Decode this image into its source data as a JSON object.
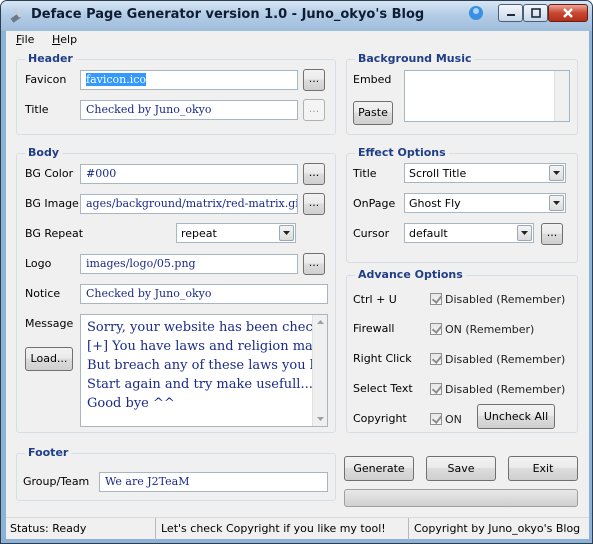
{
  "window": {
    "title": "Deface Page Generator version 1.0 - Juno_okyo's Blog"
  },
  "menu": {
    "file_prefix": "F",
    "file_rest": "ile",
    "help_prefix": "H",
    "help_rest": "elp"
  },
  "header": {
    "title": "Header",
    "favicon_label": "Favicon",
    "favicon_value": "favicon.ico",
    "title_label": "Title",
    "title_value": "Checked by Juno_okyo",
    "browse": "..."
  },
  "music": {
    "title": "Background Music",
    "embed_label": "Embed",
    "paste_label": "Paste"
  },
  "body": {
    "title": "Body",
    "bgcolor_label": "BG Color",
    "bgcolor_value": "#000",
    "bgimage_label": "BG Image",
    "bgimage_value": "ages/background/matrix/red-matrix.gif",
    "bgrepeat_label": "BG Repeat",
    "bgrepeat_value": "repeat",
    "logo_label": "Logo",
    "logo_value": "images/logo/05.png",
    "notice_label": "Notice",
    "notice_value": "Checked by Juno_okyo",
    "message_label": "Message",
    "load_label": "Load...",
    "message_lines": [
      "Sorry, your website has been check",
      "[+] You have laws and religion make",
      "But breach any of these laws you be",
      "Start again and try make usefull...",
      "Good bye ^^"
    ]
  },
  "effect": {
    "title": "Effect Options",
    "title_label": "Title",
    "title_value": "Scroll Title",
    "onpage_label": "OnPage",
    "onpage_value": "Ghost Fly",
    "cursor_label": "Cursor",
    "cursor_value": "default"
  },
  "advance": {
    "title": "Advance Options",
    "rows": [
      {
        "label": "Ctrl + U",
        "value": "Disabled (Remember)"
      },
      {
        "label": "Firewall",
        "value": "ON (Remember)"
      },
      {
        "label": "Right Click",
        "value": "Disabled (Remember)"
      },
      {
        "label": "Select Text",
        "value": "Disabled (Remember)"
      },
      {
        "label": "Copyright",
        "value": "ON"
      }
    ],
    "uncheck_label": "Uncheck All"
  },
  "footer": {
    "title": "Footer",
    "group_label": "Group/Team",
    "group_value": "We are J2TeaM"
  },
  "actions": {
    "generate": "Generate",
    "save": "Save",
    "exit": "Exit"
  },
  "status": {
    "ready": "Status: Ready",
    "message": "Let's check Copyright if you like my tool!",
    "copyright": "Copyright by Juno_okyo's Blog"
  }
}
